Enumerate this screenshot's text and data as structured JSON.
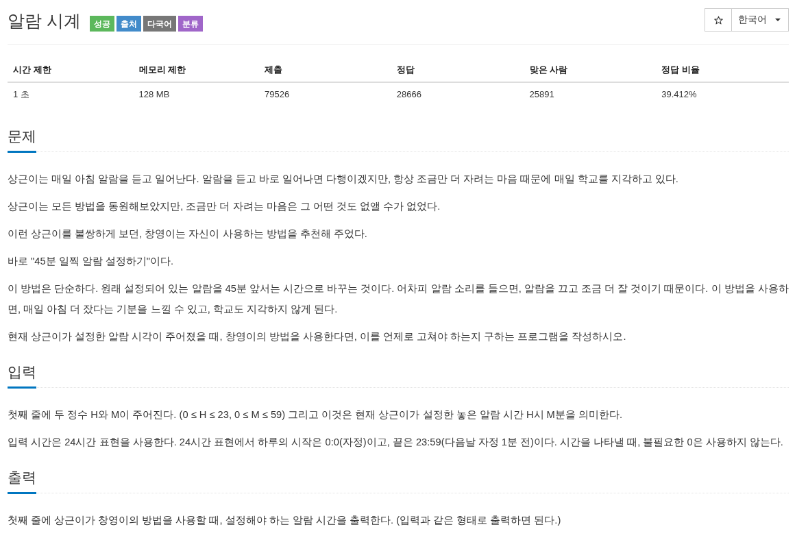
{
  "problem": {
    "title": "알람 시계",
    "labels": [
      {
        "text": "성공",
        "color": "#5cb85c"
      },
      {
        "text": "출처",
        "color": "#428bca"
      },
      {
        "text": "다국어",
        "color": "#777777"
      },
      {
        "text": "분류",
        "color": "#a066c9"
      }
    ]
  },
  "toolbar": {
    "language": "한국어"
  },
  "info_table": {
    "columns": [
      "시간 제한",
      "메모리 제한",
      "제출",
      "정답",
      "맞은 사람",
      "정답 비율"
    ],
    "rows": [
      [
        "1 초",
        "128 MB",
        "79526",
        "28666",
        "25891",
        "39.412%"
      ]
    ]
  },
  "sections": [
    {
      "heading": "문제",
      "paragraphs": [
        "상근이는 매일 아침 알람을 듣고 일어난다. 알람을 듣고 바로 일어나면 다행이겠지만, 항상 조금만 더 자려는 마음 때문에 매일 학교를 지각하고 있다.",
        "상근이는 모든 방법을 동원해보았지만, 조금만 더 자려는 마음은 그 어떤 것도 없앨 수가 없었다.",
        "이런 상근이를 불쌍하게 보던, 창영이는 자신이 사용하는 방법을 추천해 주었다.",
        "바로 \"45분 일찍 알람 설정하기\"이다.",
        "이 방법은 단순하다. 원래 설정되어 있는 알람을 45분 앞서는 시간으로 바꾸는 것이다. 어차피 알람 소리를 들으면, 알람을 끄고 조금 더 잘 것이기 때문이다. 이 방법을 사용하면, 매일 아침 더 잤다는 기분을 느낄 수 있고, 학교도 지각하지 않게 된다.",
        "현재 상근이가 설정한 알람 시각이 주어졌을 때, 창영이의 방법을 사용한다면, 이를 언제로 고쳐야 하는지 구하는 프로그램을 작성하시오."
      ]
    },
    {
      "heading": "입력",
      "paragraphs": [
        "첫째 줄에 두 정수 H와 M이 주어진다. (0 ≤ H ≤ 23, 0 ≤ M ≤ 59) 그리고 이것은 현재 상근이가 설정한 놓은 알람 시간 H시 M분을 의미한다.",
        "입력 시간은 24시간 표현을 사용한다. 24시간 표현에서 하루의 시작은 0:0(자정)이고, 끝은 23:59(다음날 자정 1분 전)이다. 시간을 나타낼 때, 불필요한 0은 사용하지 않는다."
      ]
    },
    {
      "heading": "출력",
      "paragraphs": [
        "첫째 줄에 상근이가 창영이의 방법을 사용할 때, 설정해야 하는 알람 시간을 출력한다. (입력과 같은 형태로 출력하면 된다.)"
      ]
    }
  ]
}
